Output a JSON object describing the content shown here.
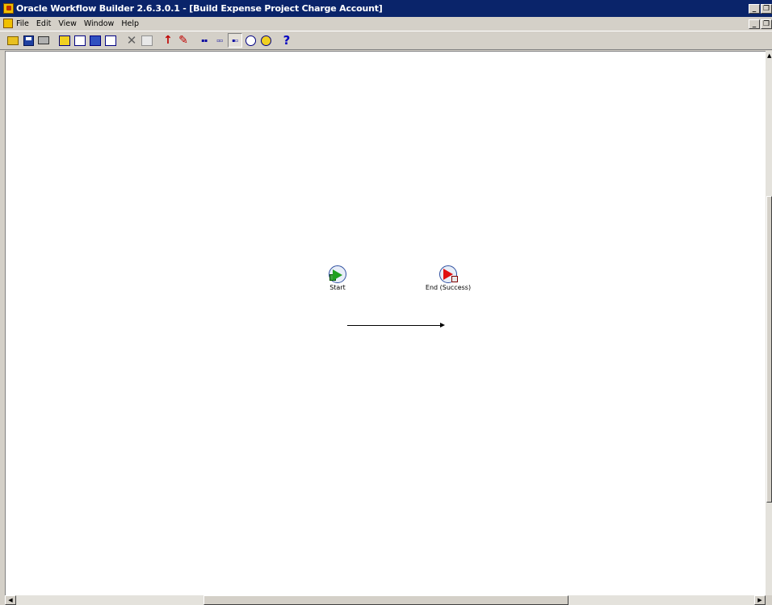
{
  "window": {
    "title": "Oracle Workflow Builder 2.6.3.0.1 - [Build Expense Project Charge Account]",
    "buttons": [
      "_",
      "❐",
      "✕"
    ]
  },
  "menu": {
    "items": [
      "File",
      "Edit",
      "View",
      "Window",
      "Help"
    ]
  },
  "toolbar": {
    "icons": [
      "open-icon",
      "save-icon",
      "print-icon",
      "new-process-icon",
      "new-notification-icon",
      "new-function-icon",
      "new-event-icon",
      "delete-icon",
      "properties-icon",
      "transition-icon",
      "edit-icon",
      "label-icon",
      "node-label-icon",
      "abc-label-icon",
      "zoom-icon",
      "smile-icon",
      "help-icon"
    ],
    "help_label": "?"
  },
  "diagram": {
    "nodes": [
      {
        "label": "Start",
        "type": "start"
      },
      {
        "label": "End (Success)",
        "type": "end"
      }
    ]
  }
}
